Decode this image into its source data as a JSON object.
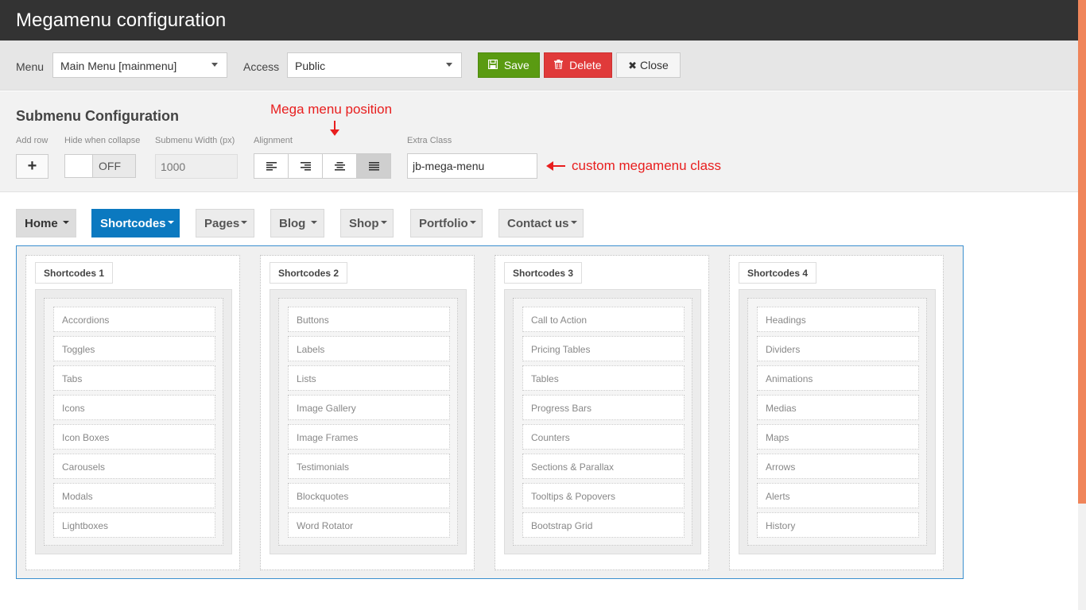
{
  "title": "Megamenu configuration",
  "toolbar": {
    "menu_label": "Menu",
    "menu_value": "Main Menu [mainmenu]",
    "access_label": "Access",
    "access_value": "Public",
    "save_label": "Save",
    "delete_label": "Delete",
    "close_label": "Close"
  },
  "submenu": {
    "heading": "Submenu Configuration",
    "add_row_label": "Add row",
    "add_row_button": "+",
    "hide_label": "Hide when collapse",
    "hide_state": "OFF",
    "width_label": "Submenu Width (px)",
    "width_placeholder": "1000",
    "alignment_label": "Alignment",
    "extra_class_label": "Extra Class",
    "extra_class_value": "jb-mega-menu"
  },
  "annotations": {
    "position": "Mega menu position",
    "custom_class": "custom megamenu class"
  },
  "nav": [
    {
      "label": "Home"
    },
    {
      "label": "Shortcodes"
    },
    {
      "label": "Pages"
    },
    {
      "label": "Blog"
    },
    {
      "label": "Shop"
    },
    {
      "label": "Portfolio"
    },
    {
      "label": "Contact us"
    }
  ],
  "columns": [
    {
      "title": "Shortcodes 1",
      "items": [
        "Accordions",
        "Toggles",
        "Tabs",
        "Icons",
        "Icon Boxes",
        "Carousels",
        "Modals",
        "Lightboxes"
      ]
    },
    {
      "title": "Shortcodes 2",
      "items": [
        "Buttons",
        "Labels",
        "Lists",
        "Image Gallery",
        "Image Frames",
        "Testimonials",
        "Blockquotes",
        "Word Rotator"
      ]
    },
    {
      "title": "Shortcodes 3",
      "items": [
        "Call to Action",
        "Pricing Tables",
        "Tables",
        "Progress Bars",
        "Counters",
        "Sections & Parallax",
        "Tooltips & Popovers",
        "Bootstrap Grid"
      ]
    },
    {
      "title": "Shortcodes 4",
      "items": [
        "Headings",
        "Dividers",
        "Animations",
        "Medias",
        "Maps",
        "Arrows",
        "Alerts",
        "History"
      ]
    }
  ],
  "colors": {
    "titlebar": "#333333",
    "save": "#5a9b12",
    "delete": "#e03a3a",
    "active_nav": "#0b79c0",
    "annotation": "#e81e1e",
    "mega_border": "#3a8fcf"
  }
}
